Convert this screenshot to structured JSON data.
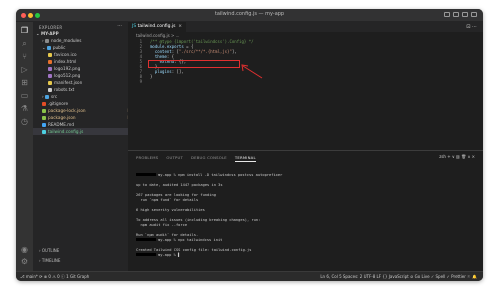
{
  "window": {
    "title": "tailwind.config.js — my-app"
  },
  "sidebar": {
    "header": "EXPLORER",
    "more": "···",
    "root": "MY-APP",
    "items": [
      {
        "label": "node_modules",
        "indent": 1,
        "kind": "folder",
        "color": "#8a8a8a"
      },
      {
        "label": "public",
        "indent": 1,
        "kind": "folder-open",
        "color": "#4ca3e0"
      },
      {
        "label": "favicon.ico",
        "indent": 2,
        "kind": "file",
        "color": "#e6c84c"
      },
      {
        "label": "index.html",
        "indent": 2,
        "kind": "file",
        "color": "#e8712c"
      },
      {
        "label": "logo192.png",
        "indent": 2,
        "kind": "file",
        "color": "#a074c4"
      },
      {
        "label": "logo512.png",
        "indent": 2,
        "kind": "file",
        "color": "#a074c4"
      },
      {
        "label": "manifest.json",
        "indent": 2,
        "kind": "file",
        "color": "#e6c84c"
      },
      {
        "label": "robots.txt",
        "indent": 2,
        "kind": "file",
        "color": "#cccccc"
      },
      {
        "label": "src",
        "indent": 1,
        "kind": "folder",
        "color": "#4ca3e0"
      },
      {
        "label": ".gitignore",
        "indent": 1,
        "kind": "file",
        "color": "#e44d26"
      },
      {
        "label": "package-lock.json",
        "indent": 1,
        "kind": "file",
        "color": "#8bc34a",
        "badge": "M"
      },
      {
        "label": "package.json",
        "indent": 1,
        "kind": "file",
        "color": "#8bc34a",
        "badge": "M"
      },
      {
        "label": "README.md",
        "indent": 1,
        "kind": "file",
        "color": "#42a5f5"
      },
      {
        "label": "tailwind.config.js",
        "indent": 1,
        "kind": "file",
        "color": "#4dd0e1",
        "badge": "U",
        "selected": true
      }
    ],
    "outline": "OUTLINE",
    "timeline": "TIMELINE"
  },
  "editor": {
    "tab_label": "tailwind.config.js",
    "tab_close": "×",
    "breadcrumb": "tailwind.config.js > ...",
    "lines": [
      {
        "n": "1",
        "segs": [
          {
            "t": "/** @type {import('tailwindcss').Config} */",
            "c": "cm"
          }
        ]
      },
      {
        "n": "2",
        "segs": [
          {
            "t": "module",
            "c": "prop"
          },
          {
            "t": ".",
            "c": "pun"
          },
          {
            "t": "exports",
            "c": "prop"
          },
          {
            "t": " = {",
            "c": "pun"
          }
        ]
      },
      {
        "n": "3",
        "segs": [
          {
            "t": "  content",
            "c": "prop"
          },
          {
            "t": ": [",
            "c": "pun"
          },
          {
            "t": "\"./src/**/*.{html,js}\"",
            "c": "str"
          },
          {
            "t": "],",
            "c": "pun"
          }
        ]
      },
      {
        "n": "4",
        "segs": [
          {
            "t": "  theme",
            "c": "prop"
          },
          {
            "t": ": {",
            "c": "pun"
          }
        ]
      },
      {
        "n": "5",
        "segs": [
          {
            "t": "    extend",
            "c": "prop"
          },
          {
            "t": ": {},",
            "c": "pun"
          }
        ]
      },
      {
        "n": "6",
        "segs": [
          {
            "t": "  },",
            "c": "pun"
          }
        ]
      },
      {
        "n": "7",
        "segs": [
          {
            "t": "  plugins",
            "c": "prop"
          },
          {
            "t": ": [],",
            "c": "pun"
          }
        ]
      },
      {
        "n": "8",
        "segs": [
          {
            "t": "}",
            "c": "pun"
          }
        ]
      },
      {
        "n": "9",
        "segs": [
          {
            "t": "",
            "c": "pun"
          }
        ]
      }
    ]
  },
  "panel": {
    "tabs": [
      {
        "label": "PROBLEMS",
        "active": false
      },
      {
        "label": "OUTPUT",
        "active": false
      },
      {
        "label": "DEBUG CONSOLE",
        "active": false
      },
      {
        "label": "TERMINAL",
        "active": true
      }
    ],
    "right": "zsh + ∨ ▥ 🗑 ∧ ×",
    "terminal": [
      {
        "text": "my-app % npm install -D tailwindcss postcss autoprefixer",
        "prompt": true
      },
      {
        "text": ""
      },
      {
        "text": "up to date, audited 1447 packages in 3s"
      },
      {
        "text": ""
      },
      {
        "text": "267 packages are looking for funding"
      },
      {
        "text": "  run `npm fund` for details"
      },
      {
        "text": ""
      },
      {
        "text": "6 high severity vulnerabilities"
      },
      {
        "text": ""
      },
      {
        "text": "To address all issues (including breaking changes), run:"
      },
      {
        "text": "  npm audit fix --force"
      },
      {
        "text": ""
      },
      {
        "text": "Run `npm audit` for details."
      },
      {
        "text": "my-app % npx tailwindcss init",
        "prompt": true
      },
      {
        "text": ""
      },
      {
        "text": "Created Tailwind CSS config file: tailwind.config.js"
      },
      {
        "text": "my-app % ▌",
        "prompt": true
      }
    ]
  },
  "status": {
    "left": "⎇ main*  ⟳  ⊗ 0 ⚠ 0 ⓘ 1   Git Graph",
    "right": "Ln 6, Col 5   Spaces: 2   UTF-8   LF   {} JavaScript   ⊘ Go Live   ✓ Spell   ✓ Prettier   ⚐ 🔔"
  },
  "colors": {
    "traffic_red": "#ff5f57",
    "traffic_yellow": "#febc2e",
    "traffic_green": "#28c840",
    "annotation": "#e03030"
  }
}
